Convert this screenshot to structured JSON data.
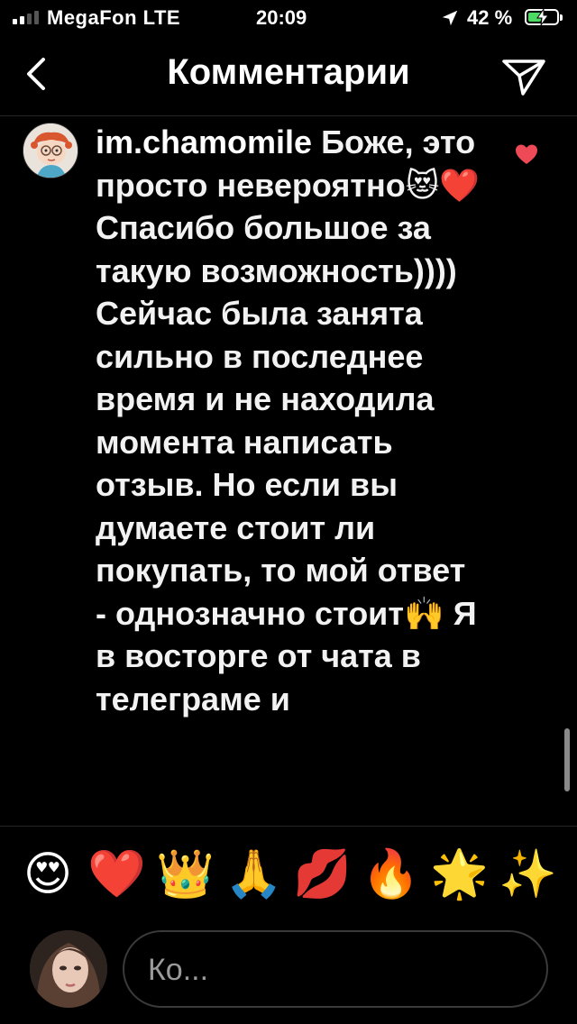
{
  "status_bar": {
    "carrier": "MegaFon LTE",
    "time": "20:09",
    "battery_percent": "42 %",
    "signal_bars": 4,
    "signal_active": 2
  },
  "header": {
    "title": "Комментарии",
    "back_icon": "chevron-left-icon",
    "send_icon": "paper-plane-icon"
  },
  "comment": {
    "username": "im.chamomile",
    "text": "Боже, это просто невероятно😻❤️ Спасибо большое за такую возможность)))) Сейчас была занята сильно в последнее время и не находила момента написать отзыв. Но если вы думаете стоит ли покупать, то мой ответ - однозначно стоит🙌 Я в восторге от чата в телеграме и",
    "liked": true,
    "like_color": "#ed4956"
  },
  "emoji_bar": [
    "😍",
    "❤️",
    "👑",
    "🙏",
    "💋",
    "🔥",
    "🌟",
    "✨"
  ],
  "composer": {
    "placeholder": "Ко..."
  }
}
